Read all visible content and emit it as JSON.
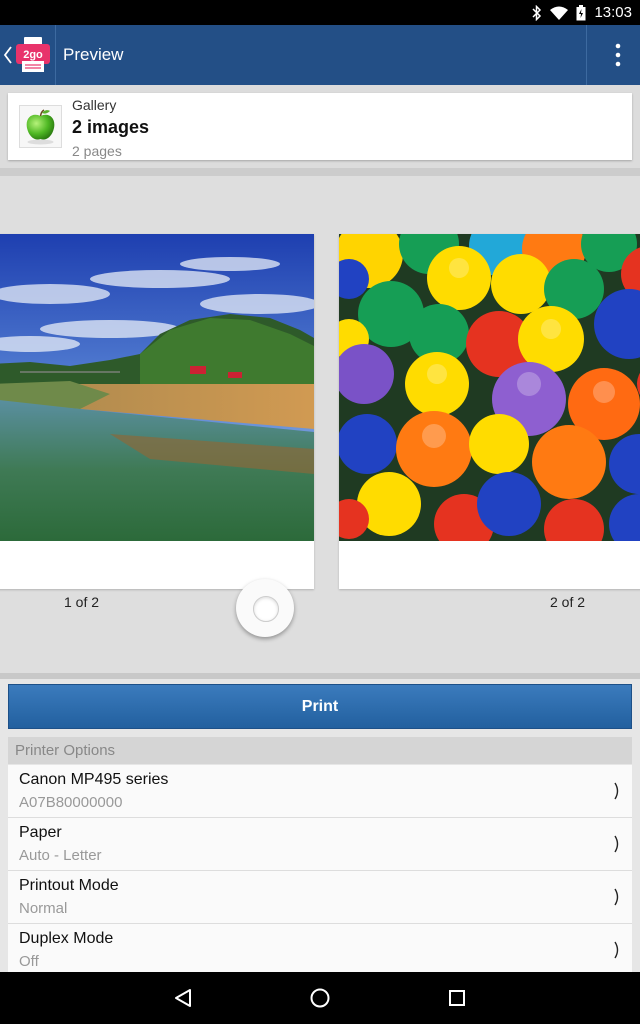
{
  "status_bar": {
    "time": "13:03",
    "icons": [
      "bluetooth-icon",
      "wifi-icon",
      "battery-icon"
    ]
  },
  "app_bar": {
    "title": "Preview",
    "icons": [
      "back-icon",
      "app-logo-2go",
      "overflow-menu-icon"
    ],
    "logo_text": "2go",
    "color": "#234f86"
  },
  "source": {
    "label": "Gallery",
    "title": "2 images",
    "subtitle": "2 pages",
    "icon": "apple-icon"
  },
  "carousel": {
    "pages": [
      {
        "label": "1 of 2",
        "image": "landscape-river-photo"
      },
      {
        "label": "2 of 2",
        "image": "colorful-balls-photo"
      }
    ],
    "shutter_icon": "circle-button-icon"
  },
  "print_button": {
    "label": "Print",
    "color": "#2a6aa9"
  },
  "printer_options": {
    "header": "Printer Options",
    "items": [
      {
        "name": "Canon MP495 series",
        "value": "A07B80000000"
      },
      {
        "name": "Paper",
        "value": "Auto - Letter"
      },
      {
        "name": "Printout Mode",
        "value": "Normal"
      },
      {
        "name": "Duplex Mode",
        "value": "Off"
      }
    ]
  },
  "nav_bar": {
    "icons": [
      "back-triangle-icon",
      "home-circle-icon",
      "recents-square-icon"
    ]
  }
}
